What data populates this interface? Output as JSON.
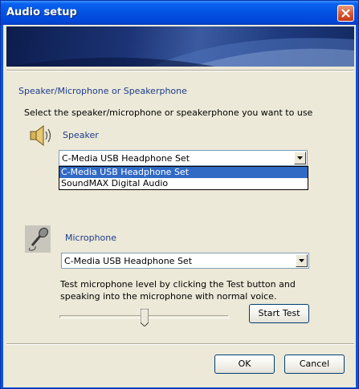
{
  "window": {
    "title": "Audio setup"
  },
  "section_title": "Speaker/Microphone or Speakerphone",
  "instruction": "Select the speaker/microphone or speakerphone you want to use",
  "speaker": {
    "label": "Speaker",
    "selected": "C-Media USB Headphone Set",
    "options": [
      "C-Media USB Headphone Set",
      "SoundMAX Digital Audio"
    ],
    "highlighted_option": "C-Media USB Headphone Set"
  },
  "microphone": {
    "label": "Microphone",
    "selected": "C-Media USB Headphone Set"
  },
  "test": {
    "text": "Test microphone level by clicking the Test button and speaking into the microphone with normal voice.",
    "button_label": "Start Test",
    "level_fraction": 0.5
  },
  "buttons": {
    "ok": "OK",
    "cancel": "Cancel"
  },
  "colors": {
    "title_bar": "#0a55e0",
    "dialog_bg": "#ece9d8",
    "link_blue": "#1c3c8c",
    "selection": "#316ac5"
  }
}
